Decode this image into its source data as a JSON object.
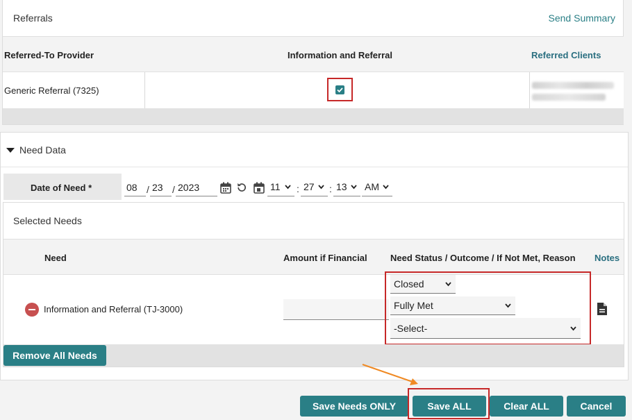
{
  "referrals": {
    "title": "Referrals",
    "send_summary": "Send Summary",
    "columns": [
      "Referred-To Provider",
      "Information and Referral",
      "Referred Clients"
    ],
    "rows": [
      {
        "provider": "Generic Referral (7325)",
        "information_and_referral_checked": true
      }
    ]
  },
  "need_data": {
    "title": "Need Data",
    "date_of_need": {
      "label": "Date of Need",
      "required_mark": "*",
      "month": "08",
      "day": "23",
      "year": "2023",
      "date_sep": "/",
      "time_sep": ":",
      "hour": "11",
      "minute": "27",
      "second": "13",
      "ampm": "AM"
    },
    "selected_needs": {
      "title": "Selected Needs",
      "columns": {
        "need": "Need",
        "amount": "Amount if Financial",
        "status": "Need Status / Outcome / If Not Met, Reason",
        "notes": "Notes"
      },
      "rows": [
        {
          "need": "Information and Referral (TJ-3000)",
          "amount": "",
          "status": "Closed",
          "outcome": "Fully Met",
          "reason": "-Select-"
        }
      ]
    },
    "remove_all": "Remove All Needs"
  },
  "actions": {
    "save_needs_only": "Save Needs ONLY",
    "save_all": "Save ALL",
    "clear_all": "Clear ALL",
    "cancel": "Cancel"
  },
  "colors": {
    "accent": "#2a7f86",
    "highlight": "#c62828",
    "arrow": "#f08a24",
    "remove": "#c75050"
  },
  "icons": [
    "calendar-icon",
    "reset-icon",
    "chevron-down-icon",
    "remove-need-icon",
    "note-document-icon",
    "checkbox-checked-icon"
  ]
}
